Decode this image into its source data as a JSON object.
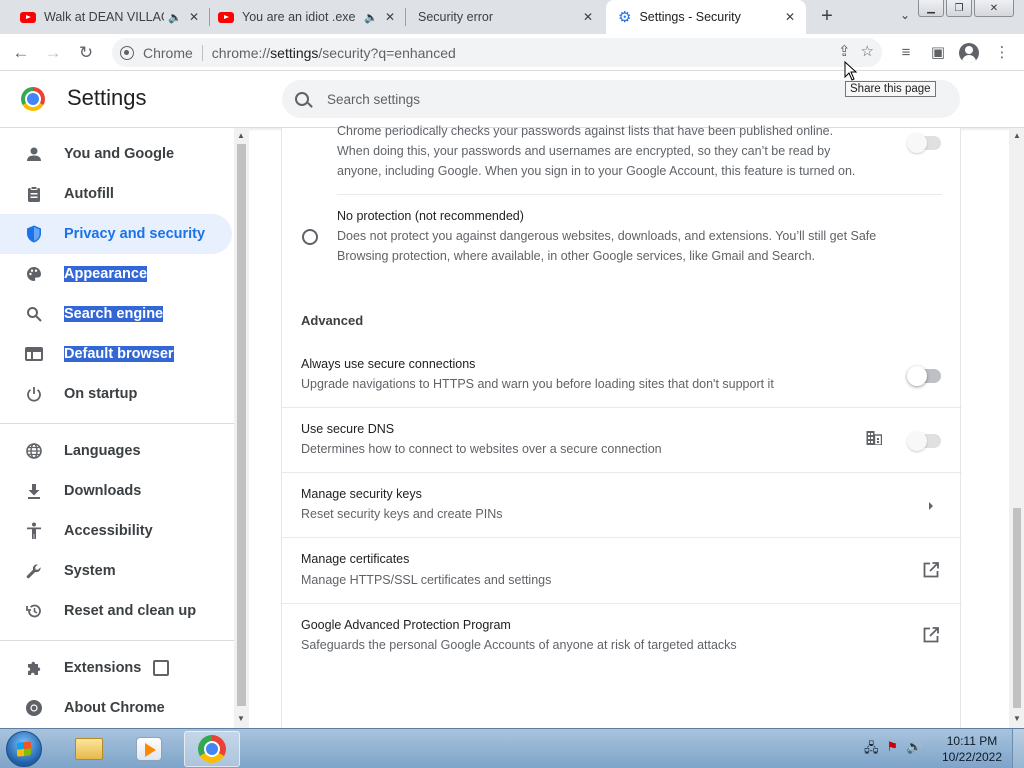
{
  "tabs": [
    {
      "title": "Walk at DEAN VILLAGE",
      "icon": "youtube-icon",
      "audio": true
    },
    {
      "title": "You are an idiot .exe",
      "icon": "youtube-icon",
      "audio": true
    },
    {
      "title": "Security error",
      "icon": "none",
      "audio": false
    },
    {
      "title": "Settings - Security",
      "icon": "gear-icon",
      "audio": false,
      "active": true
    }
  ],
  "omnibox": {
    "chip": "Chrome",
    "url_scheme": "chrome://",
    "url_host": "settings",
    "url_rest": "/security?q=enhanced"
  },
  "tooltip": "Share this page",
  "settings": {
    "title": "Settings",
    "search_placeholder": "Search settings"
  },
  "sidebar": {
    "items": [
      {
        "label": "You and Google",
        "icon": "person-icon"
      },
      {
        "label": "Autofill",
        "icon": "clipboard-icon"
      },
      {
        "label": "Privacy and security",
        "icon": "shield-icon",
        "selected": true
      },
      {
        "label": "Appearance",
        "icon": "palette-icon",
        "highlighted": true
      },
      {
        "label": "Search engine",
        "icon": "search-icon",
        "highlighted": true
      },
      {
        "label": "Default browser",
        "icon": "browser-icon",
        "highlighted": true
      },
      {
        "label": "On startup",
        "icon": "power-icon"
      },
      {
        "label": "Languages",
        "icon": "globe-icon"
      },
      {
        "label": "Downloads",
        "icon": "download-icon"
      },
      {
        "label": "Accessibility",
        "icon": "accessibility-icon"
      },
      {
        "label": "System",
        "icon": "wrench-icon"
      },
      {
        "label": "Reset and clean up",
        "icon": "history-icon"
      },
      {
        "label": "Extensions",
        "icon": "puzzle-icon"
      },
      {
        "label": "About Chrome",
        "icon": "chrome-icon"
      }
    ]
  },
  "content": {
    "password_check": {
      "line1": "Chrome periodically checks your passwords against lists that have been published online.",
      "line2": "When doing this, your passwords and usernames are encrypted, so they can’t be read by",
      "line3": "anyone, including Google. When you sign in to your Google Account, this feature is turned on."
    },
    "no_protection": {
      "title": "No protection (not recommended)",
      "line1": "Does not protect you against dangerous websites, downloads, and extensions. You’ll still get Safe",
      "line2": "Browsing protection, where available, in other Google services, like Gmail and Search."
    },
    "advanced_heading": "Advanced",
    "rows": [
      {
        "title": "Always use secure connections",
        "desc": "Upgrade navigations to HTTPS and warn you before loading sites that don't support it",
        "control": "toggle-off"
      },
      {
        "title": "Use secure DNS",
        "desc": "Determines how to connect to websites over a secure connection",
        "control": "toggle-disabled"
      },
      {
        "title": "Manage security keys",
        "desc": "Reset security keys and create PINs",
        "control": "arrow"
      },
      {
        "title": "Manage certificates",
        "desc": "Manage HTTPS/SSL certificates and settings",
        "control": "external-link"
      },
      {
        "title": "Google Advanced Protection Program",
        "desc": "Safeguards the personal Google Accounts of anyone at risk of targeted attacks",
        "control": "external-link"
      }
    ]
  },
  "taskbar": {
    "clock_time": "10:11 PM",
    "clock_date": "10/22/2022"
  },
  "colors": {
    "accent": "#1a73e8",
    "selected_bg": "#e8f0fe",
    "text_selection": "#3367d6"
  }
}
